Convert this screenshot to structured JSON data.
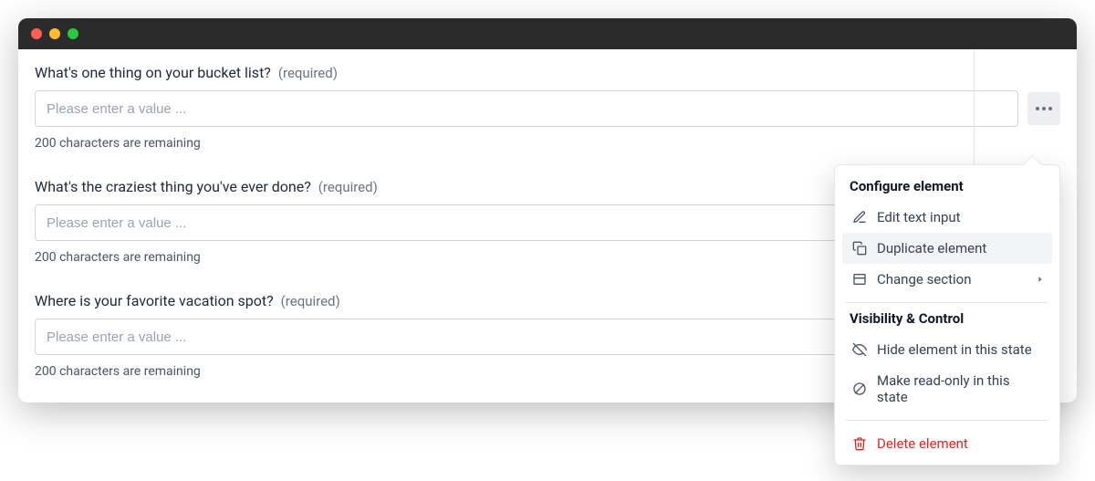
{
  "fields": [
    {
      "label": "What's one thing on your bucket list?",
      "required_text": "(required)",
      "placeholder": "Please enter a value ...",
      "remaining": "200 characters are remaining"
    },
    {
      "label": "What's the craziest thing you've ever done?",
      "required_text": "(required)",
      "placeholder": "Please enter a value ...",
      "remaining": "200 characters are remaining"
    },
    {
      "label": "Where is your favorite vacation spot?",
      "required_text": "(required)",
      "placeholder": "Please enter a value ...",
      "remaining": "200 characters are remaining"
    }
  ],
  "popover": {
    "section1_title": "Configure element",
    "edit": "Edit text input",
    "duplicate": "Duplicate element",
    "change_section": "Change section",
    "section2_title": "Visibility & Control",
    "hide": "Hide element in this state",
    "readonly": "Make read-only in this state",
    "delete": "Delete element"
  }
}
